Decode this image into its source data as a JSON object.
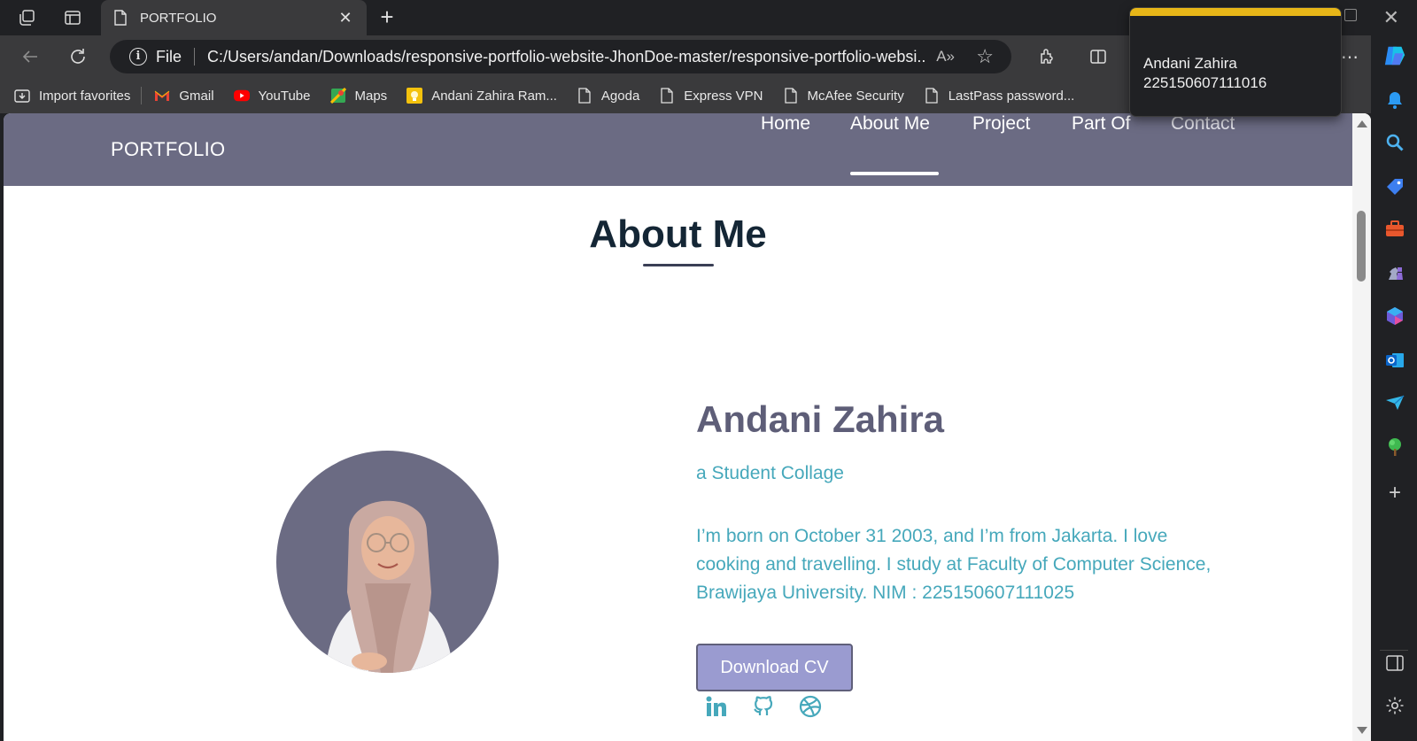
{
  "browser": {
    "tab_title": "PORTFOLIO",
    "address_scheme": "File",
    "url": "C:/Users/andan/Downloads/responsive-portfolio-website-JhonDoe-master/responsive-portfolio-websi...",
    "read_aloud": "A»"
  },
  "favorites": [
    {
      "label": "Import favorites",
      "icon": "import-icon"
    },
    {
      "label": "Gmail",
      "icon": "gmail-icon"
    },
    {
      "label": "YouTube",
      "icon": "youtube-icon"
    },
    {
      "label": "Maps",
      "icon": "maps-icon"
    },
    {
      "label": "Andani Zahira Ram...",
      "icon": "bulb-icon"
    },
    {
      "label": "Agoda",
      "icon": "page-icon"
    },
    {
      "label": "Express VPN",
      "icon": "page-icon"
    },
    {
      "label": "McAfee Security",
      "icon": "page-icon"
    },
    {
      "label": "LastPass password...",
      "icon": "page-icon"
    }
  ],
  "popup": {
    "name": "Andani Zahira",
    "id": "225150607111016",
    "accent_color": "#e7b618"
  },
  "site": {
    "logo": "PORTFOLIO",
    "nav": [
      "Home",
      "About Me",
      "Project",
      "Part Of",
      "Contact"
    ],
    "active_nav": "About Me",
    "header_color": "#6b6b83"
  },
  "about": {
    "title": "About Me",
    "name": "Andani Zahira",
    "role": "a Student Collage",
    "bio": "I’m born on October 31 2003, and I’m from Jakarta. I love cooking and travelling. I study at Faculty of Computer Science, Brawijaya University. NIM : 225150607111025",
    "cv_button": "Download CV",
    "socials": [
      "linkedin-icon",
      "github-icon",
      "dribbble-icon"
    ],
    "accent_color": "#46a8bb",
    "button_color": "#9a9bd0"
  }
}
